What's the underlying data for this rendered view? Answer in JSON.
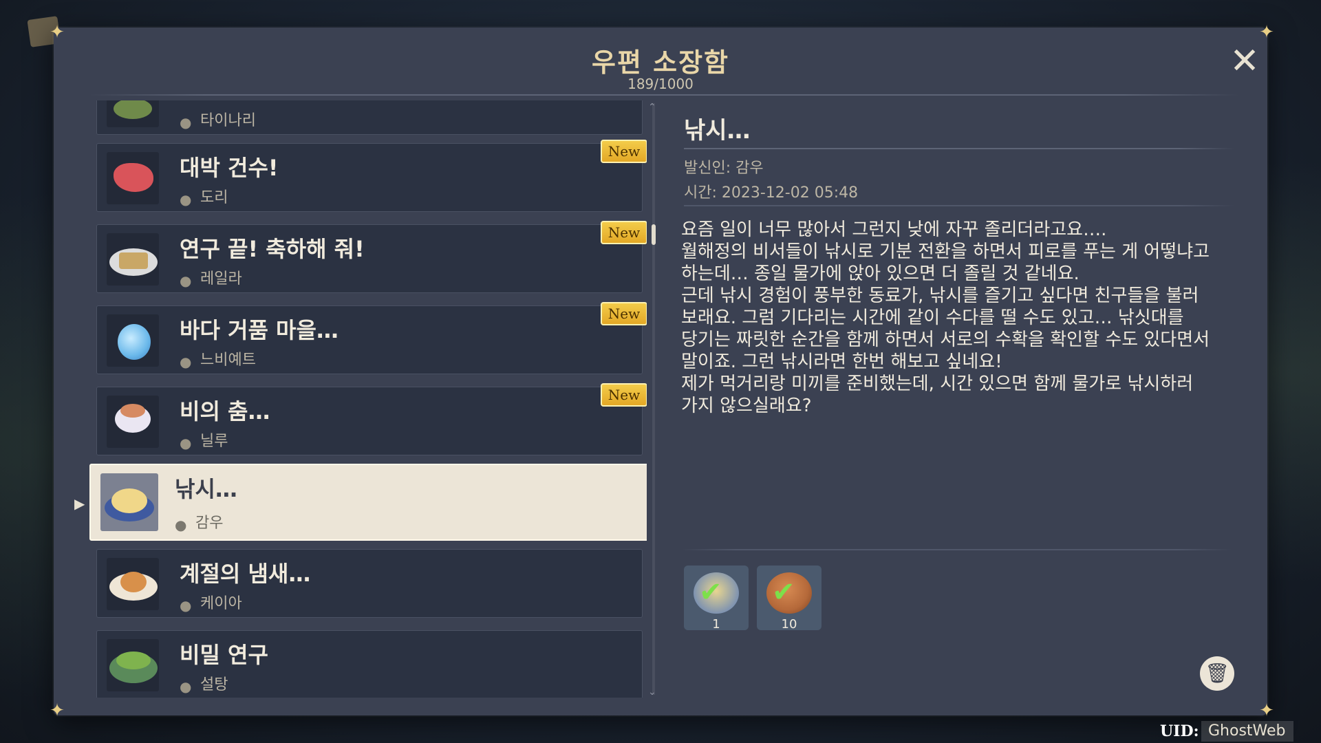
{
  "mailbox": {
    "title": "우편 소장함",
    "count": "189/1000",
    "new_label": "New"
  },
  "mail_list": [
    {
      "subject": "",
      "sender": "타이나리",
      "is_new": false,
      "food_color": "#6f8a4a"
    },
    {
      "subject": "대박 건수!",
      "sender": "도리",
      "is_new": true,
      "food_color": "#d9545a"
    },
    {
      "subject": "연구 끝! 축하해 줘!",
      "sender": "레일라",
      "is_new": true,
      "food_color": "#c9a766"
    },
    {
      "subject": "바다 거품 마을…",
      "sender": "느비예트",
      "is_new": true,
      "food_color": "#6ab8ea"
    },
    {
      "subject": "비의 춤…",
      "sender": "닐루",
      "is_new": true,
      "food_color": "#d68a62"
    },
    {
      "subject": "낚시…",
      "sender": "감우",
      "is_new": false,
      "selected": true,
      "food_color": "#f0d789"
    },
    {
      "subject": "계절의 냄새…",
      "sender": "케이아",
      "is_new": false,
      "food_color": "#d8904a"
    },
    {
      "subject": "비밀 연구",
      "sender": "설탕",
      "is_new": false,
      "food_color": "#7fb34e"
    }
  ],
  "detail": {
    "subject": "낚시…",
    "sender_line": "발신인: 감우",
    "time_line": "시간: 2023-12-02 05:48",
    "body": [
      "요즘 일이 너무 많아서 그런지 낮에 자꾸 졸리더라고요….",
      "월해정의 비서들이 낚시로 기분 전환을 하면서 피로를 푸는 게 어떻냐고",
      "하는데… 종일 물가에 앉아 있으면 더 졸릴 것 같네요.",
      "근데 낚시 경험이 풍부한 동료가, 낚시를 즐기고 싶다면 친구들을 불러",
      "보래요. 그럼 기다리는 시간에 같이 수다를 떨 수도 있고… 낚싯대를",
      "당기는 짜릿한 순간을 함께 하면서 서로의 수확을 확인할 수도 있다면서",
      "말이죠. 그런 낚시라면 한번 해보고 싶네요!",
      "제가 먹거리랑 미끼를 준비했는데, 시간 있으면 함께 물가로 낚시하러",
      "가지 않으실래요?"
    ],
    "attachments": [
      {
        "qty": "1",
        "icon": "dish-icon",
        "color": "#e8d590"
      },
      {
        "qty": "10",
        "icon": "bait-icon",
        "color": "#b5693a"
      }
    ]
  },
  "footer": {
    "uid_label": "UID:",
    "uid_value": "GhostWeb"
  }
}
